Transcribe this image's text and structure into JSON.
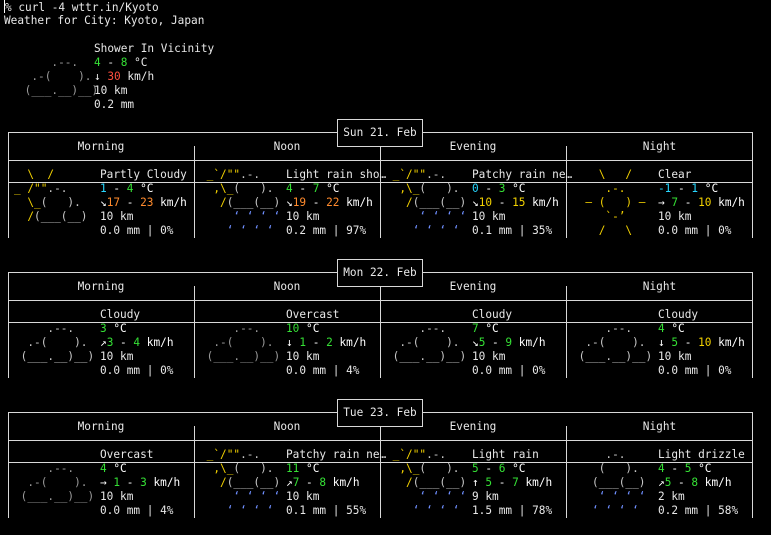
{
  "prompt": {
    "symbol": "% ",
    "command": "curl -4 wttr.in/Kyoto"
  },
  "location_line": "Weather for City: Kyoto, Japan",
  "current": {
    "condition": "Shower In Vicinity",
    "temp_low": "4",
    "temp_sep": " - ",
    "temp_high": "8",
    "temp_unit": " °C",
    "wind_arrow": "↓",
    "wind_speed": "30",
    "wind_unit": " km/h",
    "visibility": "10 km",
    "precip": "0.2 mm",
    "icon": "cloud-icon",
    "colors": {
      "temp": "#35e035",
      "wind": "#ff4f3f"
    }
  },
  "periods": [
    "Morning",
    "Noon",
    "Evening",
    "Night"
  ],
  "days": [
    {
      "date": "Sun 21. Feb",
      "slots": [
        {
          "icon": "partly-cloudy-icon",
          "condition": "Partly Cloudy",
          "temp": [
            {
              "t": "1",
              "c": "cyan"
            },
            {
              "t": " - ",
              "c": "w"
            },
            {
              "t": "4",
              "c": "green"
            },
            {
              "t": " °C",
              "c": "w"
            }
          ],
          "wind": [
            {
              "t": "↘",
              "c": "w"
            },
            {
              "t": "17",
              "c": "orange"
            },
            {
              "t": " - ",
              "c": "w"
            },
            {
              "t": "23",
              "c": "orange"
            },
            {
              "t": " km/h",
              "c": "w"
            }
          ],
          "visibility": "10 km",
          "precip": "0.0 mm | 0%"
        },
        {
          "icon": "light-rain-icon",
          "condition": "Light rain sho…",
          "temp": [
            {
              "t": "4",
              "c": "green"
            },
            {
              "t": " - ",
              "c": "w"
            },
            {
              "t": "7",
              "c": "green"
            },
            {
              "t": " °C",
              "c": "w"
            }
          ],
          "wind": [
            {
              "t": "↘",
              "c": "w"
            },
            {
              "t": "19",
              "c": "orange"
            },
            {
              "t": " - ",
              "c": "w"
            },
            {
              "t": "22",
              "c": "orange"
            },
            {
              "t": " km/h",
              "c": "w"
            }
          ],
          "visibility": "10 km",
          "precip": "0.2 mm | 97%"
        },
        {
          "icon": "patchy-rain-icon",
          "condition": "Patchy rain ne…",
          "temp": [
            {
              "t": "0",
              "c": "cyan"
            },
            {
              "t": " - ",
              "c": "w"
            },
            {
              "t": "3",
              "c": "green"
            },
            {
              "t": " °C",
              "c": "w"
            }
          ],
          "wind": [
            {
              "t": "↘",
              "c": "w"
            },
            {
              "t": "10",
              "c": "y"
            },
            {
              "t": " - ",
              "c": "w"
            },
            {
              "t": "15",
              "c": "y"
            },
            {
              "t": " km/h",
              "c": "w"
            }
          ],
          "visibility": "10 km",
          "precip": "0.1 mm | 35%"
        },
        {
          "icon": "clear-night-icon",
          "condition": "Clear",
          "temp": [
            {
              "t": "-1",
              "c": "cyan"
            },
            {
              "t": " - ",
              "c": "w"
            },
            {
              "t": "1",
              "c": "cyan"
            },
            {
              "t": " °C",
              "c": "w"
            }
          ],
          "wind": [
            {
              "t": "→",
              "c": "w"
            },
            {
              "t": " ",
              "c": "w"
            },
            {
              "t": "7",
              "c": "green"
            },
            {
              "t": " - ",
              "c": "w"
            },
            {
              "t": "10",
              "c": "y"
            },
            {
              "t": " km/h",
              "c": "w"
            }
          ],
          "visibility": "10 km",
          "precip": "0.0 mm | 0%"
        }
      ]
    },
    {
      "date": "Mon 22. Feb",
      "slots": [
        {
          "icon": "cloudy-icon",
          "condition": "Cloudy",
          "temp": [
            {
              "t": "3",
              "c": "green"
            },
            {
              "t": " °C",
              "c": "w"
            }
          ],
          "wind": [
            {
              "t": "↗",
              "c": "w"
            },
            {
              "t": "3",
              "c": "green"
            },
            {
              "t": " - ",
              "c": "w"
            },
            {
              "t": "4",
              "c": "green"
            },
            {
              "t": " km/h",
              "c": "w"
            }
          ],
          "visibility": "10 km",
          "precip": "0.0 mm | 0%"
        },
        {
          "icon": "overcast-icon",
          "condition": "Overcast",
          "temp": [
            {
              "t": "10",
              "c": "green"
            },
            {
              "t": " °C",
              "c": "w"
            }
          ],
          "wind": [
            {
              "t": "↓",
              "c": "w"
            },
            {
              "t": " ",
              "c": "w"
            },
            {
              "t": "1",
              "c": "green"
            },
            {
              "t": " - ",
              "c": "w"
            },
            {
              "t": "2",
              "c": "green"
            },
            {
              "t": " km/h",
              "c": "w"
            }
          ],
          "visibility": "10 km",
          "precip": "0.0 mm | 4%"
        },
        {
          "icon": "cloudy-icon",
          "condition": "Cloudy",
          "temp": [
            {
              "t": "7",
              "c": "green"
            },
            {
              "t": " °C",
              "c": "w"
            }
          ],
          "wind": [
            {
              "t": "↘",
              "c": "w"
            },
            {
              "t": "5",
              "c": "green"
            },
            {
              "t": " - ",
              "c": "w"
            },
            {
              "t": "9",
              "c": "green"
            },
            {
              "t": " km/h",
              "c": "w"
            }
          ],
          "visibility": "10 km",
          "precip": "0.0 mm | 0%"
        },
        {
          "icon": "cloudy-icon",
          "condition": "Cloudy",
          "temp": [
            {
              "t": "4",
              "c": "green"
            },
            {
              "t": " °C",
              "c": "w"
            }
          ],
          "wind": [
            {
              "t": "↓",
              "c": "w"
            },
            {
              "t": " ",
              "c": "w"
            },
            {
              "t": "5",
              "c": "green"
            },
            {
              "t": " - ",
              "c": "w"
            },
            {
              "t": "10",
              "c": "y"
            },
            {
              "t": " km/h",
              "c": "w"
            }
          ],
          "visibility": "10 km",
          "precip": "0.0 mm | 0%"
        }
      ]
    },
    {
      "date": "Tue 23. Feb",
      "slots": [
        {
          "icon": "overcast-icon",
          "condition": "Overcast",
          "temp": [
            {
              "t": "4",
              "c": "green"
            },
            {
              "t": " °C",
              "c": "w"
            }
          ],
          "wind": [
            {
              "t": "→",
              "c": "w"
            },
            {
              "t": " ",
              "c": "w"
            },
            {
              "t": "1",
              "c": "green"
            },
            {
              "t": " - ",
              "c": "w"
            },
            {
              "t": "3",
              "c": "green"
            },
            {
              "t": " km/h",
              "c": "w"
            }
          ],
          "visibility": "10 km",
          "precip": "0.0 mm | 4%"
        },
        {
          "icon": "patchy-rain-icon",
          "condition": "Patchy rain ne…",
          "temp": [
            {
              "t": "11",
              "c": "green"
            },
            {
              "t": " °C",
              "c": "w"
            }
          ],
          "wind": [
            {
              "t": "↗",
              "c": "w"
            },
            {
              "t": "7",
              "c": "green"
            },
            {
              "t": " - ",
              "c": "w"
            },
            {
              "t": "8",
              "c": "green"
            },
            {
              "t": " km/h",
              "c": "w"
            }
          ],
          "visibility": "10 km",
          "precip": "0.1 mm | 55%"
        },
        {
          "icon": "light-rain-icon",
          "condition": "Light rain",
          "temp": [
            {
              "t": "5",
              "c": "green"
            },
            {
              "t": " - ",
              "c": "w"
            },
            {
              "t": "6",
              "c": "green"
            },
            {
              "t": " °C",
              "c": "w"
            }
          ],
          "wind": [
            {
              "t": "↑",
              "c": "w"
            },
            {
              "t": " ",
              "c": "w"
            },
            {
              "t": "5",
              "c": "green"
            },
            {
              "t": " - ",
              "c": "w"
            },
            {
              "t": "7",
              "c": "green"
            },
            {
              "t": " km/h",
              "c": "w"
            }
          ],
          "visibility": "9 km",
          "precip": "1.5 mm | 78%"
        },
        {
          "icon": "light-drizzle-icon",
          "condition": "Light drizzle",
          "temp": [
            {
              "t": "4",
              "c": "green"
            },
            {
              "t": " - ",
              "c": "w"
            },
            {
              "t": "5",
              "c": "green"
            },
            {
              "t": " °C",
              "c": "w"
            }
          ],
          "wind": [
            {
              "t": "↗",
              "c": "w"
            },
            {
              "t": "5",
              "c": "green"
            },
            {
              "t": " - ",
              "c": "w"
            },
            {
              "t": "8",
              "c": "green"
            },
            {
              "t": " km/h",
              "c": "w"
            }
          ],
          "visibility": "2 km",
          "precip": "0.2 mm | 58%"
        }
      ]
    }
  ]
}
